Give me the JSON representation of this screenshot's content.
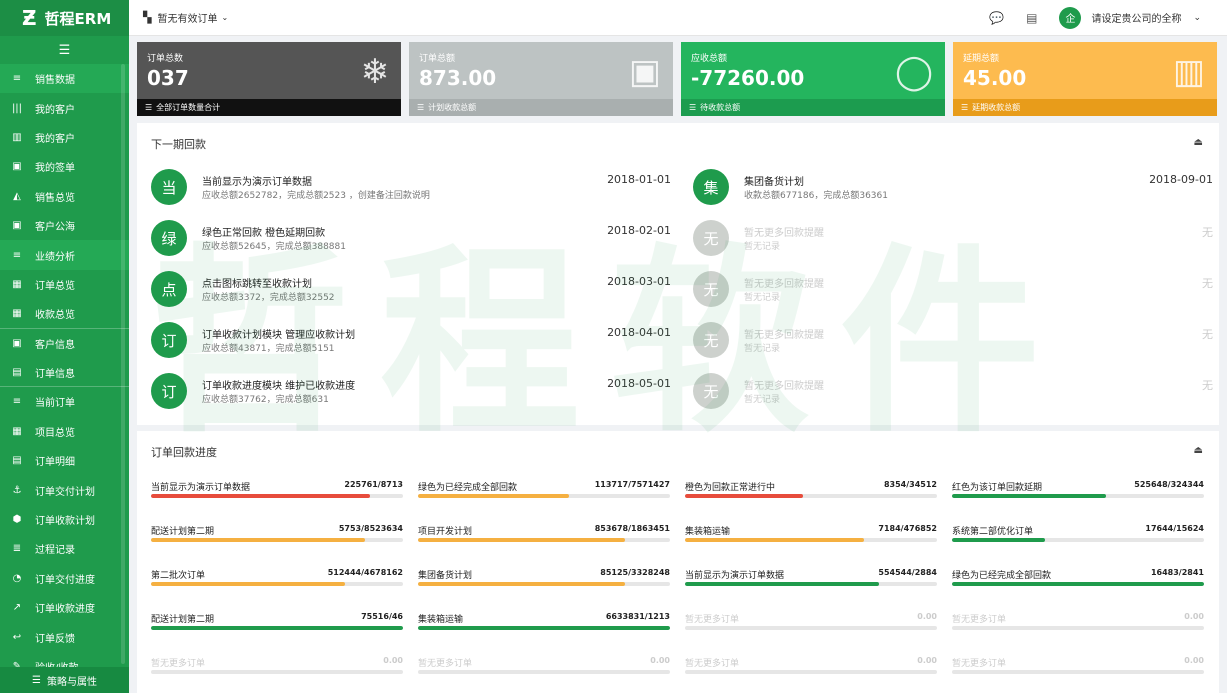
{
  "brand": {
    "logo": "Ƶ",
    "title": "哲程ERM"
  },
  "sidebar": {
    "items": [
      {
        "label": "销售数据",
        "icon": "≡",
        "active": true
      },
      {
        "label": "我的客户",
        "icon": "|||"
      },
      {
        "label": "我的客户",
        "icon": "▥"
      },
      {
        "label": "我的签单",
        "icon": "▣"
      },
      {
        "label": "销售总览",
        "icon": "◭"
      },
      {
        "label": "客户公海",
        "icon": "▣"
      },
      {
        "label": "业绩分析",
        "icon": "≡",
        "active": true
      },
      {
        "label": "订单总览",
        "icon": "▦"
      },
      {
        "label": "收款总览",
        "icon": "▦"
      },
      {
        "label": "客户信息",
        "icon": "▣"
      },
      {
        "label": "订单信息",
        "icon": "▤"
      },
      {
        "label": "当前订单",
        "icon": "≡"
      },
      {
        "label": "项目总览",
        "icon": "▦"
      },
      {
        "label": "订单明细",
        "icon": "▤"
      },
      {
        "label": "订单交付计划",
        "icon": "⚓"
      },
      {
        "label": "订单收款计划",
        "icon": "⬢"
      },
      {
        "label": "过程记录",
        "icon": "≣"
      },
      {
        "label": "订单交付进度",
        "icon": "◔"
      },
      {
        "label": "订单收款进度",
        "icon": "↗"
      },
      {
        "label": "订单反馈",
        "icon": "↩"
      },
      {
        "label": "验收/收款",
        "icon": "✎"
      }
    ],
    "footer": "策略与属性"
  },
  "topbar": {
    "order_status": "暂无有效订单",
    "company": "请设定贵公司的全称",
    "avatar_text": "企"
  },
  "stats": [
    {
      "label": "订单总数",
      "value": "037",
      "foot": "全部订单数量合计",
      "color": "#555555",
      "foot_color": "#111111",
      "icon": "❄"
    },
    {
      "label": "订单总额",
      "value": "873.00",
      "foot": "计划收款总额",
      "color": "#bdc3c3",
      "foot_color": "#a9afaf",
      "icon": "▣"
    },
    {
      "label": "应收总额",
      "value": "-77260.00",
      "foot": "待收款总额",
      "color": "#24b55e",
      "foot_color": "#1c9c4f",
      "icon": "◯"
    },
    {
      "label": "延期总额",
      "value": "45.00",
      "foot": "延期收款总额",
      "color": "#fdbb4f",
      "foot_color": "#e89c1a",
      "icon": "▥"
    }
  ],
  "plan": {
    "title": "下一期回款",
    "left": [
      {
        "badge": "当",
        "title": "当前显示为演示订单数据",
        "sub": "应收总额2652782，完成总额2523 ，创建备注回款说明",
        "date": "2018-01-01"
      },
      {
        "badge": "绿",
        "title": "绿色正常回款 橙色延期回款",
        "sub": "应收总额52645，完成总额388881",
        "date": "2018-02-01"
      },
      {
        "badge": "点",
        "title": "点击图标跳转至收款计划",
        "sub": "应收总额3372，完成总额32552",
        "date": "2018-03-01"
      },
      {
        "badge": "订",
        "title": "订单收款计划模块 管理应收款计划",
        "sub": "应收总额43871，完成总额5151",
        "date": "2018-04-01"
      },
      {
        "badge": "订",
        "title": "订单收款进度模块 维护已收款进度",
        "sub": "应收总额37762，完成总额631",
        "date": "2018-05-01"
      }
    ],
    "right": [
      {
        "badge": "集",
        "title": "集团备货计划",
        "sub": "收款总额677186，完成总额36361",
        "date": "2018-09-01",
        "empty": false
      },
      {
        "badge": "无",
        "title": "暂无更多回款提醒",
        "sub": "暂无记录",
        "date": "无",
        "empty": true
      },
      {
        "badge": "无",
        "title": "暂无更多回款提醒",
        "sub": "暂无记录",
        "date": "无",
        "empty": true
      },
      {
        "badge": "无",
        "title": "暂无更多回款提醒",
        "sub": "暂无记录",
        "date": "无",
        "empty": true
      },
      {
        "badge": "无",
        "title": "暂无更多回款提醒",
        "sub": "暂无记录",
        "date": "无",
        "empty": true
      }
    ]
  },
  "progress": {
    "title": "订单回款进度",
    "rows": [
      [
        {
          "name": "当前显示为演示订单数据",
          "value": "225761/8713",
          "pct": 87,
          "color": "#e74c3c"
        },
        {
          "name": "绿色为已经完成全部回款",
          "value": "113717/7571427",
          "pct": 60,
          "color": "#f5b041"
        },
        {
          "name": "橙色为回款正常进行中",
          "value": "8354/34512",
          "pct": 47,
          "color": "#e74c3c"
        },
        {
          "name": "红色为该订单回款延期",
          "value": "525648/324344",
          "pct": 61,
          "color": "#1f9b4c"
        }
      ],
      [
        {
          "name": "配送计划第二期",
          "value": "5753/8523634",
          "pct": 85,
          "color": "#f5b041"
        },
        {
          "name": "项目开发计划",
          "value": "853678/1863451",
          "pct": 82,
          "color": "#f5b041"
        },
        {
          "name": "集装箱运输",
          "value": "7184/476852",
          "pct": 71,
          "color": "#f5b041"
        },
        {
          "name": "系统第二部优化订单",
          "value": "17644/15624",
          "pct": 37,
          "color": "#1f9b4c"
        }
      ],
      [
        {
          "name": "第二批次订单",
          "value": "512444/4678162",
          "pct": 77,
          "color": "#f5b041"
        },
        {
          "name": "集团备货计划",
          "value": "85125/3328248",
          "pct": 82,
          "color": "#f5b041"
        },
        {
          "name": "当前显示为演示订单数据",
          "value": "554544/2884",
          "pct": 77,
          "color": "#1f9b4c"
        },
        {
          "name": "绿色为已经完成全部回款",
          "value": "16483/2841",
          "pct": 100,
          "color": "#1f9b4c"
        }
      ],
      [
        {
          "name": "配送计划第二期",
          "value": "75516/46",
          "pct": 100,
          "color": "#1f9b4c"
        },
        {
          "name": "集装箱运输",
          "value": "6633831/1213",
          "pct": 100,
          "color": "#1f9b4c"
        },
        {
          "name": "暂无更多订单",
          "value": "0.00",
          "pct": 0,
          "color": "#1f9b4c",
          "empty": true
        },
        {
          "name": "暂无更多订单",
          "value": "0.00",
          "pct": 0,
          "color": "#1f9b4c",
          "empty": true
        }
      ],
      [
        {
          "name": "暂无更多订单",
          "value": "0.00",
          "pct": 0,
          "color": "#1f9b4c",
          "empty": true
        },
        {
          "name": "暂无更多订单",
          "value": "0.00",
          "pct": 0,
          "color": "#1f9b4c",
          "empty": true
        },
        {
          "name": "暂无更多订单",
          "value": "0.00",
          "pct": 0,
          "color": "#1f9b4c",
          "empty": true
        },
        {
          "name": "暂无更多订单",
          "value": "0.00",
          "pct": 0,
          "color": "#1f9b4c",
          "empty": true
        }
      ]
    ]
  },
  "watermark": "哲程软件"
}
